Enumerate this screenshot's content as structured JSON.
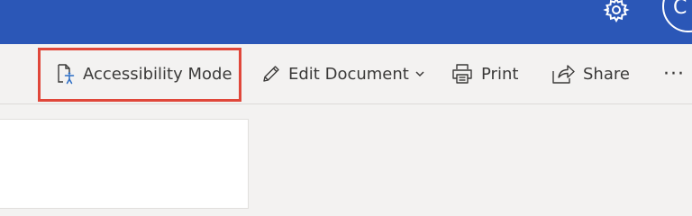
{
  "header": {
    "settings_icon": "gear-icon",
    "avatar_initial": "C",
    "accent_color": "#2b57b7"
  },
  "toolbar": {
    "accessibility_mode": {
      "label": "Accessibility Mode",
      "icon": "accessibility-document-icon",
      "highlighted": true,
      "highlight_color": "#e0473a"
    },
    "edit_document": {
      "label": "Edit Document",
      "icon": "pencil-icon"
    },
    "print": {
      "label": "Print",
      "icon": "printer-icon"
    },
    "share": {
      "label": "Share",
      "icon": "share-icon"
    },
    "more": {
      "label": "···",
      "icon": "more-options-icon"
    }
  }
}
